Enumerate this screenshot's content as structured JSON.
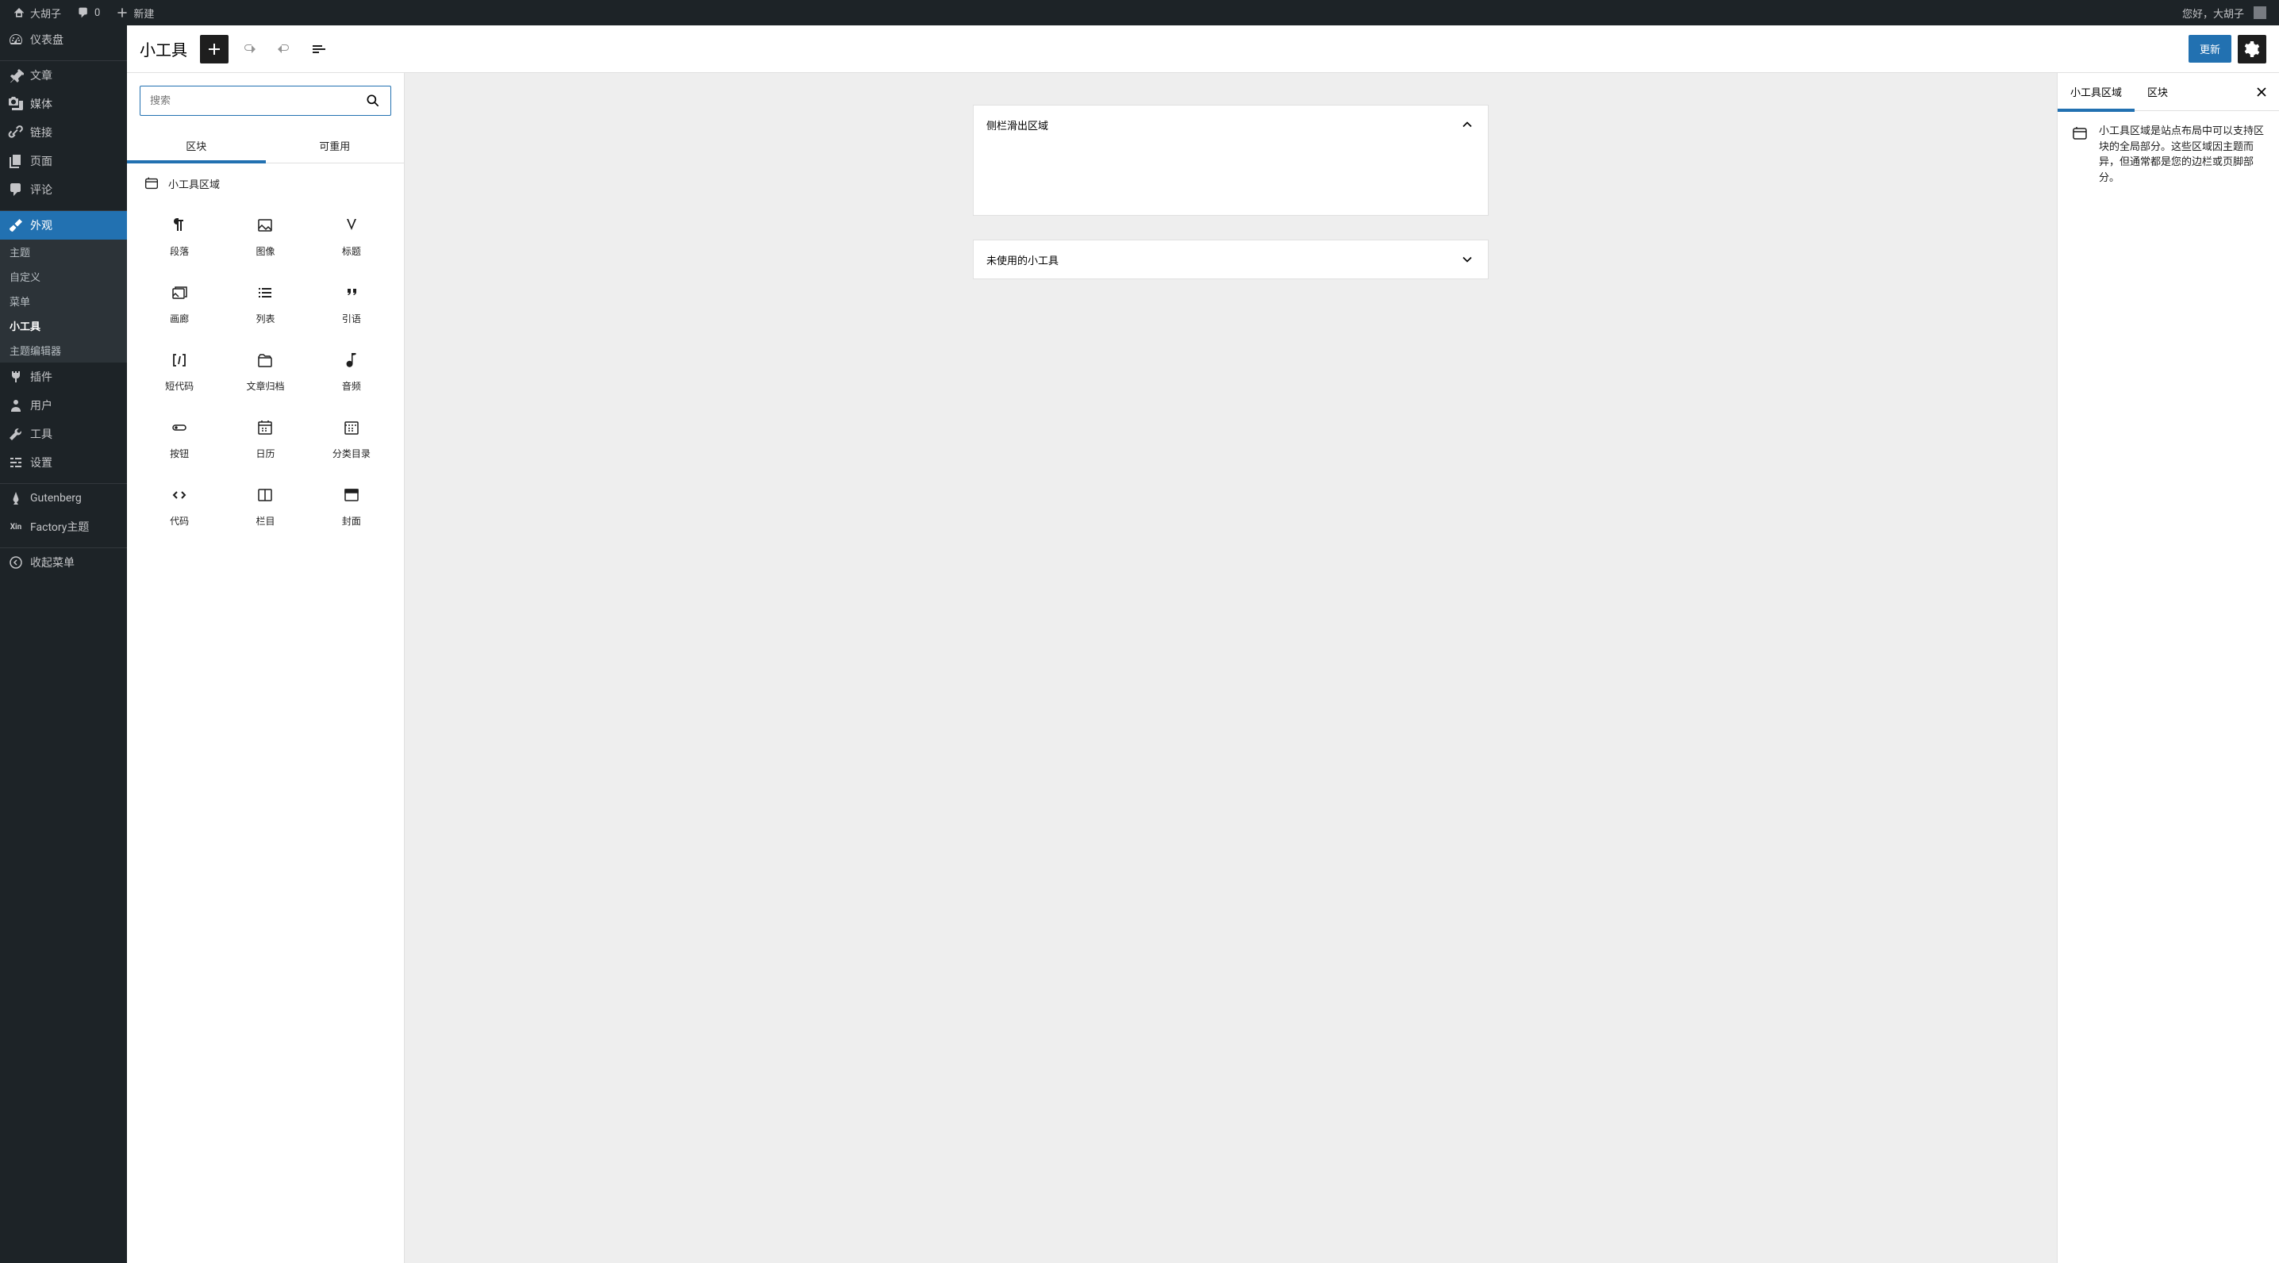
{
  "adminbar": {
    "site_name": "大胡子",
    "comments_count": "0",
    "new_label": "新建",
    "greeting": "您好，大胡子"
  },
  "sidebar": {
    "dashboard": "仪表盘",
    "posts": "文章",
    "media": "媒体",
    "links": "链接",
    "pages": "页面",
    "comments": "评论",
    "appearance": "外观",
    "appearance_sub": {
      "themes": "主题",
      "customize": "自定义",
      "menus": "菜单",
      "widgets": "小工具",
      "editor": "主题编辑器"
    },
    "plugins": "插件",
    "users": "用户",
    "tools": "工具",
    "settings": "设置",
    "gutenberg": "Gutenberg",
    "factory": "Factory主题",
    "collapse": "收起菜单"
  },
  "editor": {
    "title": "小工具",
    "update_btn": "更新"
  },
  "inserter": {
    "search_placeholder": "搜索",
    "tab_blocks": "区块",
    "tab_reusable": "可重用",
    "section_widget_area": "小工具区域",
    "blocks": [
      {
        "id": "paragraph",
        "label": "段落"
      },
      {
        "id": "image",
        "label": "图像"
      },
      {
        "id": "heading",
        "label": "标题"
      },
      {
        "id": "gallery",
        "label": "画廊"
      },
      {
        "id": "list",
        "label": "列表"
      },
      {
        "id": "quote",
        "label": "引语"
      },
      {
        "id": "shortcode",
        "label": "短代码"
      },
      {
        "id": "archives",
        "label": "文章归档"
      },
      {
        "id": "audio",
        "label": "音频"
      },
      {
        "id": "button",
        "label": "按钮"
      },
      {
        "id": "calendar",
        "label": "日历"
      },
      {
        "id": "categories",
        "label": "分类目录"
      },
      {
        "id": "code",
        "label": "代码"
      },
      {
        "id": "columns",
        "label": "栏目"
      },
      {
        "id": "cover",
        "label": "封面"
      }
    ]
  },
  "canvas": {
    "area1": "侧栏滑出区域",
    "area2": "未使用的小工具"
  },
  "settings": {
    "tab1": "小工具区域",
    "tab2": "区块",
    "description": "小工具区域是站点布局中可以支持区块的全局部分。这些区域因主题而异，但通常都是您的边栏或页脚部分。"
  }
}
